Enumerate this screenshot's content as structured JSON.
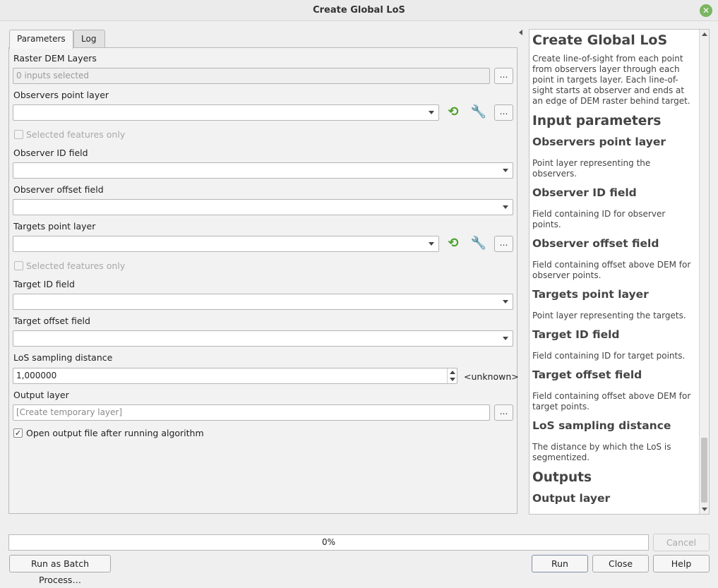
{
  "window": {
    "title": "Create Global LoS",
    "close_glyph": "✕"
  },
  "tabs": [
    {
      "label": "Parameters"
    },
    {
      "label": "Log"
    }
  ],
  "form": {
    "raster_dem": {
      "label": "Raster DEM Layers",
      "placeholder": "0 inputs selected",
      "button": "…"
    },
    "observers": {
      "label": "Observers point layer",
      "value": "",
      "more": "…",
      "selected_only": "Selected features only"
    },
    "observer_id": {
      "label": "Observer ID field",
      "value": ""
    },
    "observer_offset": {
      "label": "Observer offset field",
      "value": ""
    },
    "targets": {
      "label": "Targets point layer",
      "value": "",
      "more": "…",
      "selected_only": "Selected features only"
    },
    "target_id": {
      "label": "Target ID field",
      "value": ""
    },
    "target_offset": {
      "label": "Target offset field",
      "value": ""
    },
    "sampling": {
      "label": "LoS sampling distance",
      "value": "1,000000",
      "unit": "<unknown>"
    },
    "output": {
      "label": "Output layer",
      "placeholder": "[Create temporary layer]",
      "button": "…"
    },
    "open_output": {
      "label": "Open output file after running algorithm",
      "checked": true,
      "mark": "✓"
    }
  },
  "help": {
    "title": "Create Global LoS",
    "intro": "Create line-of-sight from each point from observers layer through each point in targets layer. Each line-of-sight starts at observer and ends at an edge of DEM raster behind target.",
    "input_heading": "Input parameters",
    "params": [
      {
        "name": "Observers point layer",
        "desc": "Point layer representing the observers."
      },
      {
        "name": "Observer ID field",
        "desc": "Field containing ID for observer points."
      },
      {
        "name": "Observer offset field",
        "desc": "Field containing offset above DEM for observer points."
      },
      {
        "name": "Targets point layer",
        "desc": "Point layer representing the targets."
      },
      {
        "name": "Target ID field",
        "desc": "Field containing ID for target points."
      },
      {
        "name": "Target offset field",
        "desc": "Field containing offset above DEM for target points."
      },
      {
        "name": "LoS sampling distance",
        "desc": "The distance by which the LoS is segmentized."
      }
    ],
    "outputs_heading": "Outputs",
    "outputs_first": "Output layer"
  },
  "progress": {
    "value": 0,
    "label": "0%"
  },
  "buttons": {
    "cancel": "Cancel",
    "batch": "Run as Batch Process…",
    "run": "Run",
    "close": "Close",
    "help": "Help"
  },
  "icons": {
    "refresh": "refresh-icon",
    "wrench": "wrench-icon",
    "accent": "#4aa02c"
  }
}
